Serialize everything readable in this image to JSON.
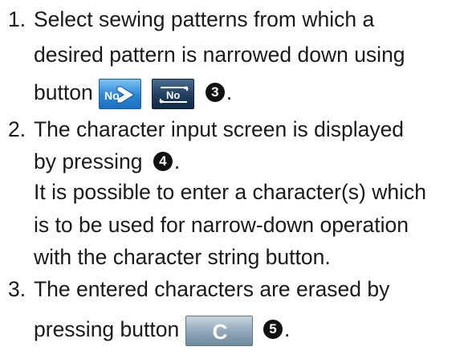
{
  "items": [
    {
      "number": "1.",
      "line1": "Select sewing patterns from which a",
      "line2": "desired pattern is narrowed down using",
      "line3_prefix": "button",
      "badge": "3",
      "suffix": "."
    },
    {
      "number": "2.",
      "line1": "The character input screen is displayed",
      "line2_prefix": "by pressing",
      "badge": "4",
      "suffix": ".",
      "line3": "It is possible to enter a character(s) which",
      "line4": "is to be used for narrow-down operation",
      "line5": "with the character string button."
    },
    {
      "number": "3.",
      "line1": "The entered characters are erased by",
      "line2_prefix": "pressing button",
      "badge": "5",
      "suffix": "."
    }
  ],
  "buttons": {
    "no_forward": "No",
    "no_reverse": "No",
    "clear": "C"
  }
}
